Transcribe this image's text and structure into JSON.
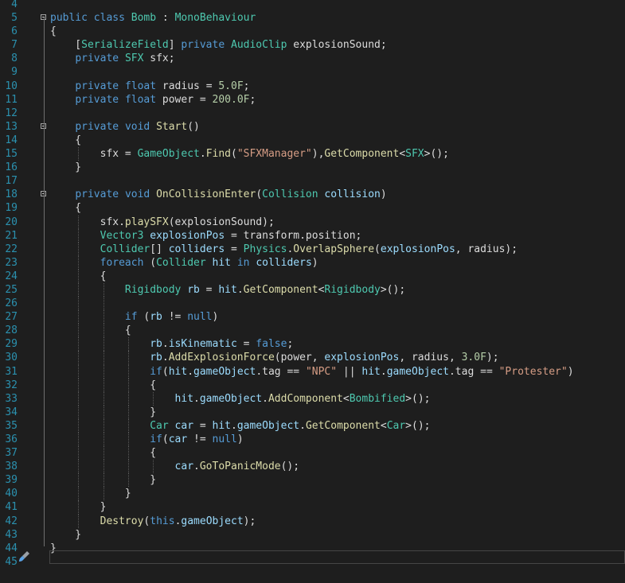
{
  "editor": {
    "lines": [
      {
        "n": "4",
        "fold": false,
        "indent": 0,
        "tokens": []
      },
      {
        "n": "5",
        "fold": true,
        "indent": 0,
        "tokens": [
          [
            "k",
            "public"
          ],
          [
            "p",
            " "
          ],
          [
            "k",
            "class"
          ],
          [
            "p",
            " "
          ],
          [
            "t",
            "Bomb"
          ],
          [
            "p",
            " : "
          ],
          [
            "t",
            "MonoBehaviour"
          ]
        ]
      },
      {
        "n": "6",
        "fold": false,
        "indent": 0,
        "tokens": [
          [
            "p",
            "{"
          ]
        ]
      },
      {
        "n": "7",
        "fold": false,
        "indent": 1,
        "tokens": [
          [
            "p",
            "    ["
          ],
          [
            "t",
            "SerializeField"
          ],
          [
            "p",
            "] "
          ],
          [
            "k",
            "private"
          ],
          [
            "p",
            " "
          ],
          [
            "t",
            "AudioClip"
          ],
          [
            "p",
            " explosionSound;"
          ]
        ]
      },
      {
        "n": "8",
        "fold": false,
        "indent": 1,
        "tokens": [
          [
            "p",
            "    "
          ],
          [
            "k",
            "private"
          ],
          [
            "p",
            " "
          ],
          [
            "t",
            "SFX"
          ],
          [
            "p",
            " sfx;"
          ]
        ]
      },
      {
        "n": "9",
        "fold": false,
        "indent": 1,
        "tokens": []
      },
      {
        "n": "10",
        "fold": false,
        "indent": 1,
        "tokens": [
          [
            "p",
            "    "
          ],
          [
            "k",
            "private"
          ],
          [
            "p",
            " "
          ],
          [
            "k",
            "float"
          ],
          [
            "p",
            " radius = "
          ],
          [
            "n",
            "5.0F"
          ],
          [
            "p",
            ";"
          ]
        ]
      },
      {
        "n": "11",
        "fold": false,
        "indent": 1,
        "tokens": [
          [
            "p",
            "    "
          ],
          [
            "k",
            "private"
          ],
          [
            "p",
            " "
          ],
          [
            "k",
            "float"
          ],
          [
            "p",
            " power = "
          ],
          [
            "n",
            "200.0F"
          ],
          [
            "p",
            ";"
          ]
        ]
      },
      {
        "n": "12",
        "fold": false,
        "indent": 1,
        "tokens": []
      },
      {
        "n": "13",
        "fold": true,
        "indent": 1,
        "tokens": [
          [
            "p",
            "    "
          ],
          [
            "k",
            "private"
          ],
          [
            "p",
            " "
          ],
          [
            "k",
            "void"
          ],
          [
            "p",
            " "
          ],
          [
            "m",
            "Start"
          ],
          [
            "p",
            "()"
          ]
        ]
      },
      {
        "n": "14",
        "fold": false,
        "indent": 1,
        "tokens": [
          [
            "p",
            "    {"
          ]
        ]
      },
      {
        "n": "15",
        "fold": false,
        "indent": 2,
        "tokens": [
          [
            "p",
            "        sfx = "
          ],
          [
            "t",
            "GameObject"
          ],
          [
            "p",
            "."
          ],
          [
            "m",
            "Find"
          ],
          [
            "p",
            "("
          ],
          [
            "s",
            "\"SFXManager\""
          ],
          [
            "p",
            "),"
          ],
          [
            "m",
            "GetComponent"
          ],
          [
            "p",
            "<"
          ],
          [
            "t",
            "SFX"
          ],
          [
            "p",
            ">();"
          ]
        ]
      },
      {
        "n": "16",
        "fold": false,
        "indent": 1,
        "tokens": [
          [
            "p",
            "    }"
          ]
        ]
      },
      {
        "n": "17",
        "fold": false,
        "indent": 1,
        "tokens": []
      },
      {
        "n": "18",
        "fold": true,
        "indent": 1,
        "tokens": [
          [
            "p",
            "    "
          ],
          [
            "k",
            "private"
          ],
          [
            "p",
            " "
          ],
          [
            "k",
            "void"
          ],
          [
            "p",
            " "
          ],
          [
            "m",
            "OnCollisionEnter"
          ],
          [
            "p",
            "("
          ],
          [
            "t",
            "Collision"
          ],
          [
            "p",
            " "
          ],
          [
            "v",
            "collision"
          ],
          [
            "p",
            ")"
          ]
        ]
      },
      {
        "n": "19",
        "fold": false,
        "indent": 1,
        "tokens": [
          [
            "p",
            "    {"
          ]
        ]
      },
      {
        "n": "20",
        "fold": false,
        "indent": 2,
        "tokens": [
          [
            "p",
            "        sfx."
          ],
          [
            "m",
            "playSFX"
          ],
          [
            "p",
            "(explosionSound);"
          ]
        ]
      },
      {
        "n": "21",
        "fold": false,
        "indent": 2,
        "tokens": [
          [
            "p",
            "        "
          ],
          [
            "t",
            "Vector3"
          ],
          [
            "p",
            " "
          ],
          [
            "v",
            "explosionPos"
          ],
          [
            "p",
            " = transform.position;"
          ]
        ]
      },
      {
        "n": "22",
        "fold": false,
        "indent": 2,
        "tokens": [
          [
            "p",
            "        "
          ],
          [
            "t",
            "Collider"
          ],
          [
            "p",
            "[] "
          ],
          [
            "v",
            "colliders"
          ],
          [
            "p",
            " = "
          ],
          [
            "t",
            "Physics"
          ],
          [
            "p",
            "."
          ],
          [
            "m",
            "OverlapSphere"
          ],
          [
            "p",
            "("
          ],
          [
            "v",
            "explosionPos"
          ],
          [
            "p",
            ", radius);"
          ]
        ]
      },
      {
        "n": "23",
        "fold": false,
        "indent": 2,
        "tokens": [
          [
            "p",
            "        "
          ],
          [
            "k",
            "foreach"
          ],
          [
            "p",
            " ("
          ],
          [
            "t",
            "Collider"
          ],
          [
            "p",
            " "
          ],
          [
            "v",
            "hit"
          ],
          [
            "p",
            " "
          ],
          [
            "k",
            "in"
          ],
          [
            "p",
            " "
          ],
          [
            "v",
            "colliders"
          ],
          [
            "p",
            ")"
          ]
        ]
      },
      {
        "n": "24",
        "fold": false,
        "indent": 2,
        "tokens": [
          [
            "p",
            "        {"
          ]
        ]
      },
      {
        "n": "25",
        "fold": false,
        "indent": 3,
        "tokens": [
          [
            "p",
            "            "
          ],
          [
            "t",
            "Rigidbody"
          ],
          [
            "p",
            " "
          ],
          [
            "v",
            "rb"
          ],
          [
            "p",
            " = "
          ],
          [
            "v",
            "hit"
          ],
          [
            "p",
            "."
          ],
          [
            "m",
            "GetComponent"
          ],
          [
            "p",
            "<"
          ],
          [
            "t",
            "Rigidbody"
          ],
          [
            "p",
            ">();"
          ]
        ]
      },
      {
        "n": "26",
        "fold": false,
        "indent": 3,
        "tokens": []
      },
      {
        "n": "27",
        "fold": false,
        "indent": 3,
        "tokens": [
          [
            "p",
            "            "
          ],
          [
            "k",
            "if"
          ],
          [
            "p",
            " ("
          ],
          [
            "v",
            "rb"
          ],
          [
            "p",
            " != "
          ],
          [
            "k",
            "null"
          ],
          [
            "p",
            ")"
          ]
        ]
      },
      {
        "n": "28",
        "fold": false,
        "indent": 3,
        "tokens": [
          [
            "p",
            "            {"
          ]
        ]
      },
      {
        "n": "29",
        "fold": false,
        "indent": 4,
        "tokens": [
          [
            "p",
            "                "
          ],
          [
            "v",
            "rb"
          ],
          [
            "p",
            "."
          ],
          [
            "v",
            "isKinematic"
          ],
          [
            "p",
            " = "
          ],
          [
            "k",
            "false"
          ],
          [
            "p",
            ";"
          ]
        ]
      },
      {
        "n": "30",
        "fold": false,
        "indent": 4,
        "tokens": [
          [
            "p",
            "                "
          ],
          [
            "v",
            "rb"
          ],
          [
            "p",
            "."
          ],
          [
            "m",
            "AddExplosionForce"
          ],
          [
            "p",
            "(power, "
          ],
          [
            "v",
            "explosionPos"
          ],
          [
            "p",
            ", radius, "
          ],
          [
            "n",
            "3.0F"
          ],
          [
            "p",
            ");"
          ]
        ]
      },
      {
        "n": "31",
        "fold": false,
        "indent": 4,
        "tokens": [
          [
            "p",
            "                "
          ],
          [
            "k",
            "if"
          ],
          [
            "p",
            "("
          ],
          [
            "v",
            "hit"
          ],
          [
            "p",
            "."
          ],
          [
            "v",
            "gameObject"
          ],
          [
            "p",
            ".tag == "
          ],
          [
            "s",
            "\"NPC\""
          ],
          [
            "p",
            " || "
          ],
          [
            "v",
            "hit"
          ],
          [
            "p",
            "."
          ],
          [
            "v",
            "gameObject"
          ],
          [
            "p",
            ".tag == "
          ],
          [
            "s",
            "\"Protester\""
          ],
          [
            "p",
            ")"
          ]
        ]
      },
      {
        "n": "32",
        "fold": false,
        "indent": 4,
        "tokens": [
          [
            "p",
            "                {"
          ]
        ]
      },
      {
        "n": "33",
        "fold": false,
        "indent": 5,
        "tokens": [
          [
            "p",
            "                    "
          ],
          [
            "v",
            "hit"
          ],
          [
            "p",
            "."
          ],
          [
            "v",
            "gameObject"
          ],
          [
            "p",
            "."
          ],
          [
            "m",
            "AddComponent"
          ],
          [
            "p",
            "<"
          ],
          [
            "t",
            "Bombified"
          ],
          [
            "p",
            ">();"
          ]
        ]
      },
      {
        "n": "34",
        "fold": false,
        "indent": 4,
        "tokens": [
          [
            "p",
            "                }"
          ]
        ]
      },
      {
        "n": "35",
        "fold": false,
        "indent": 4,
        "tokens": [
          [
            "p",
            "                "
          ],
          [
            "t",
            "Car"
          ],
          [
            "p",
            " "
          ],
          [
            "v",
            "car"
          ],
          [
            "p",
            " = "
          ],
          [
            "v",
            "hit"
          ],
          [
            "p",
            "."
          ],
          [
            "v",
            "gameObject"
          ],
          [
            "p",
            "."
          ],
          [
            "m",
            "GetComponent"
          ],
          [
            "p",
            "<"
          ],
          [
            "t",
            "Car"
          ],
          [
            "p",
            ">();"
          ]
        ]
      },
      {
        "n": "36",
        "fold": false,
        "indent": 4,
        "tokens": [
          [
            "p",
            "                "
          ],
          [
            "k",
            "if"
          ],
          [
            "p",
            "("
          ],
          [
            "v",
            "car"
          ],
          [
            "p",
            " != "
          ],
          [
            "k",
            "null"
          ],
          [
            "p",
            ")"
          ]
        ]
      },
      {
        "n": "37",
        "fold": false,
        "indent": 4,
        "tokens": [
          [
            "p",
            "                {"
          ]
        ]
      },
      {
        "n": "38",
        "fold": false,
        "indent": 5,
        "tokens": [
          [
            "p",
            "                    "
          ],
          [
            "v",
            "car"
          ],
          [
            "p",
            "."
          ],
          [
            "m",
            "GoToPanicMode"
          ],
          [
            "p",
            "();"
          ]
        ]
      },
      {
        "n": "39",
        "fold": false,
        "indent": 4,
        "tokens": [
          [
            "p",
            "                }"
          ]
        ]
      },
      {
        "n": "40",
        "fold": false,
        "indent": 3,
        "tokens": [
          [
            "p",
            "            }"
          ]
        ]
      },
      {
        "n": "41",
        "fold": false,
        "indent": 2,
        "tokens": [
          [
            "p",
            "        }"
          ]
        ]
      },
      {
        "n": "42",
        "fold": false,
        "indent": 2,
        "tokens": [
          [
            "p",
            "        "
          ],
          [
            "m",
            "Destroy"
          ],
          [
            "p",
            "("
          ],
          [
            "k",
            "this"
          ],
          [
            "p",
            "."
          ],
          [
            "v",
            "gameObject"
          ],
          [
            "p",
            ");"
          ]
        ]
      },
      {
        "n": "43",
        "fold": false,
        "indent": 1,
        "tokens": [
          [
            "p",
            "    }"
          ]
        ]
      },
      {
        "n": "44",
        "fold": false,
        "indent": 0,
        "tokens": [
          [
            "p",
            "}"
          ]
        ]
      },
      {
        "n": "45",
        "fold": false,
        "indent": 0,
        "tokens": []
      }
    ]
  },
  "colors": {
    "background": "#1e1e1e",
    "line_number": "#2b91af",
    "keyword": "#569cd6",
    "type": "#4ec9b0",
    "string": "#d69d85",
    "variable": "#9cdcfe",
    "number": "#b5cea8",
    "method": "#dcdcaa"
  },
  "icons": {
    "quick_action": "paintbrush-icon"
  }
}
